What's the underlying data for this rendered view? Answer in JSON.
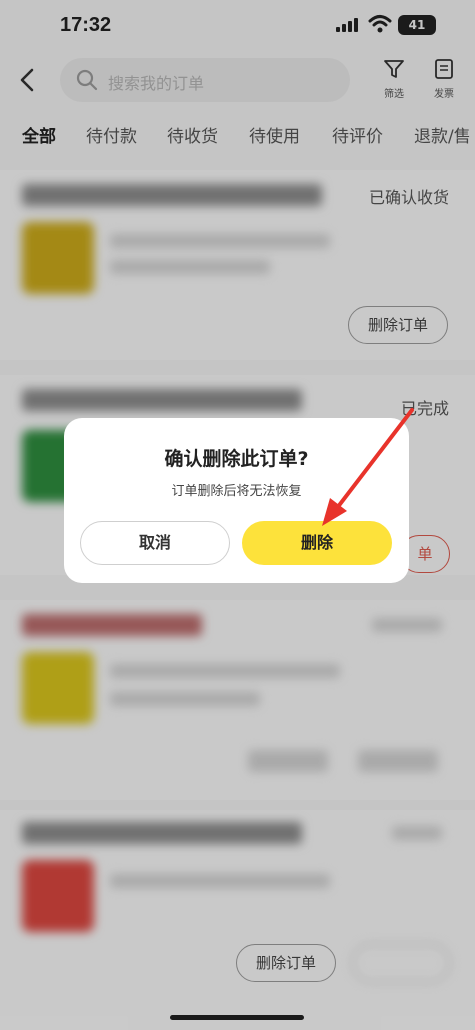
{
  "status_bar": {
    "time": "17:32",
    "battery": "41"
  },
  "header": {
    "search_placeholder": "搜索我的订单",
    "filter_label": "筛选",
    "invoice_label": "发票"
  },
  "tabs": [
    {
      "label": "全部",
      "active": true
    },
    {
      "label": "待付款"
    },
    {
      "label": "待收货"
    },
    {
      "label": "待使用"
    },
    {
      "label": "待评价"
    },
    {
      "label": "退款/售"
    }
  ],
  "orders": [
    {
      "status": "已确认收货",
      "action": "删除订单"
    },
    {
      "status": "已完成",
      "action": "单"
    },
    {
      "action": "删除订单"
    }
  ],
  "dialog": {
    "title": "确认删除此订单?",
    "message": "订单删除后将无法恢复",
    "cancel_label": "取消",
    "delete_label": "删除"
  },
  "colors": {
    "accent": "#fde23b",
    "annotation": "#e8332b"
  }
}
